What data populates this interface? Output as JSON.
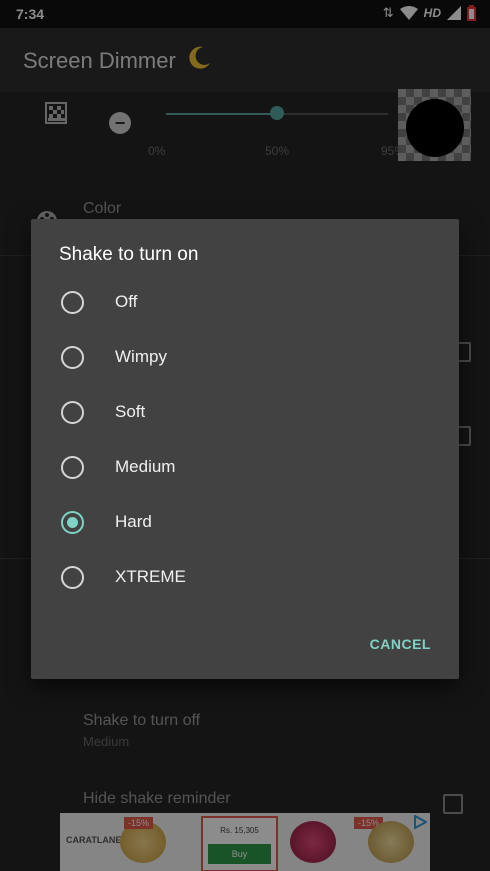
{
  "status_bar": {
    "time": "7:34",
    "network": "HD"
  },
  "app_bar": {
    "title": "Screen Dimmer"
  },
  "dim_slider": {
    "value_fraction": 0.5,
    "ticks": [
      "0%",
      "50%",
      "95%"
    ]
  },
  "settings": {
    "color_label": "Color",
    "shake_off_label": "Shake to turn off",
    "shake_off_value": "Medium",
    "hide_reminder_label": "Hide shake reminder"
  },
  "ad": {
    "brand": "CARATLANE",
    "tag_1": "-15%",
    "tag_2": "-15%",
    "price": "Rs. 15,305",
    "buy_label": "Buy"
  },
  "dialog": {
    "title": "Shake to turn on",
    "options": [
      "Off",
      "Wimpy",
      "Soft",
      "Medium",
      "Hard",
      "XTREME"
    ],
    "selected": "Hard",
    "cancel_label": "CANCEL"
  },
  "colors": {
    "accent": "#7fd3c4",
    "slider": "#5aa7a0",
    "dialog_bg": "#424242"
  }
}
